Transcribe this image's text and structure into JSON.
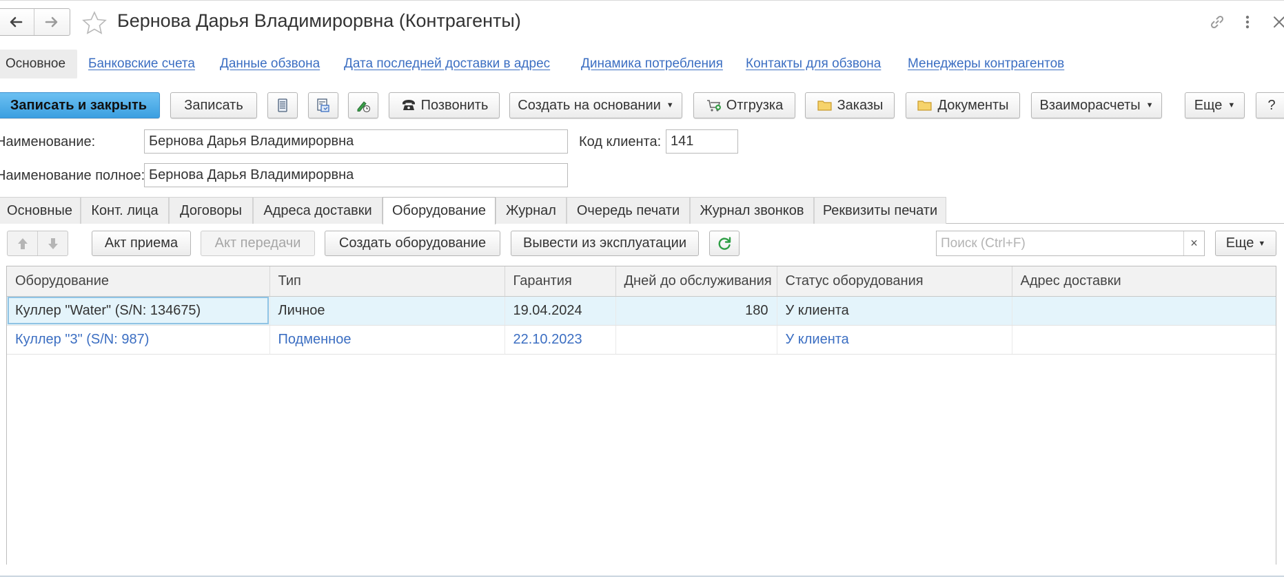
{
  "window": {
    "title": "Бернова Дарья Владимирорвна (Контрагенты)"
  },
  "sections": [
    {
      "label": "Основное"
    },
    {
      "label": "Банковские счета"
    },
    {
      "label": "Данные обзвона"
    },
    {
      "label": "Дата последней доставки в адрес"
    },
    {
      "label": "Динамика потребления"
    },
    {
      "label": "Контакты для обзвона"
    },
    {
      "label": "Менеджеры контрагентов"
    }
  ],
  "toolbar": {
    "save_close": "Записать и закрыть",
    "save": "Записать",
    "call": "Позвонить",
    "create_based": "Создать на основании",
    "shipment": "Отгрузка",
    "orders": "Заказы",
    "documents": "Документы",
    "settlements": "Взаиморасчеты",
    "more": "Еще",
    "help": "?"
  },
  "form": {
    "name_label": "Наименование:",
    "name_value": "Бернова Дарья Владимирорвна",
    "client_code_label": "Код клиента:",
    "client_code_value": "141",
    "full_name_label": "Наименование полное:",
    "full_name_value": "Бернова Дарья Владимирорвна"
  },
  "tabs": [
    {
      "label": "Основные"
    },
    {
      "label": "Конт. лица"
    },
    {
      "label": "Договоры"
    },
    {
      "label": "Адреса доставки"
    },
    {
      "label": "Оборудование"
    },
    {
      "label": "Журнал"
    },
    {
      "label": "Очередь печати"
    },
    {
      "label": "Журнал звонков"
    },
    {
      "label": "Реквизиты печати"
    }
  ],
  "equipment_toolbar": {
    "act_receive": "Акт приема",
    "act_transfer": "Акт передачи",
    "create_equipment": "Создать оборудование",
    "decommission": "Вывести из эксплуатации",
    "search_placeholder": "Поиск (Ctrl+F)",
    "clear": "×",
    "more": "Еще"
  },
  "table": {
    "columns": [
      "Оборудование",
      "Тип",
      "Гарантия",
      "Дней до обслуживания",
      "Статус оборудования",
      "Адрес доставки"
    ],
    "rows": [
      {
        "equipment": "Куллер \"Water\" (S/N: 134675)",
        "type": "Личное",
        "warranty": "19.04.2024",
        "days": "180",
        "status": "У клиента",
        "address": ""
      },
      {
        "equipment": "Куллер \"3\" (S/N: 987)",
        "type": "Подменное",
        "warranty": "22.10.2023",
        "days": "",
        "status": "У клиента",
        "address": ""
      }
    ]
  },
  "colors": {
    "primary_button": "#3b9fe0",
    "link": "#3b6ec2",
    "selected_row": "#e4f4fb",
    "refresh_green": "#2e9e45"
  }
}
